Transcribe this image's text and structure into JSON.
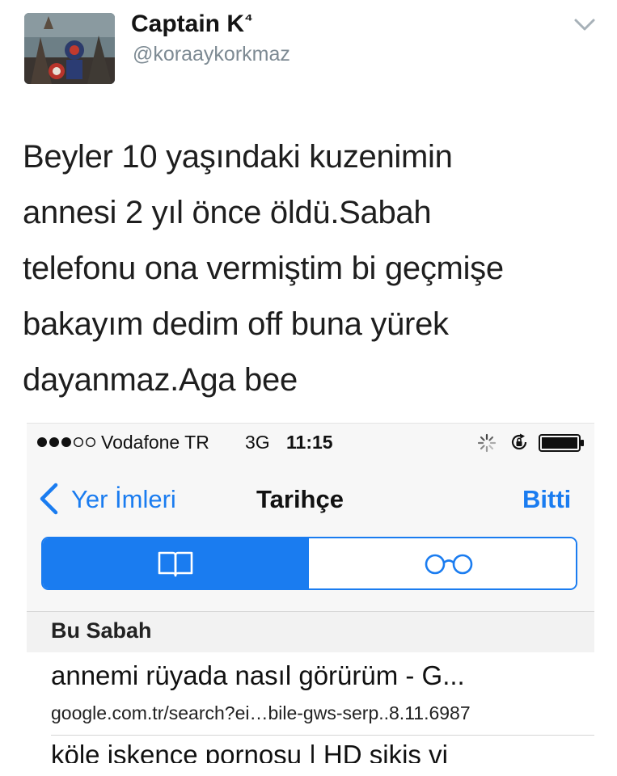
{
  "tweet": {
    "display_name": "Captain K",
    "name_badge": "⁴",
    "handle": "@koraaykorkmaz",
    "lines": [
      "Beyler 10 yaşındaki kuzenimin",
      "annesi 2 yıl önce öldü.Sabah",
      "telefonu ona vermiştim bi geçmişe",
      "bakayım dedim off buna yürek",
      "dayanmaz.Aga bee"
    ]
  },
  "phone": {
    "status_bar": {
      "carrier": "Vodafone TR",
      "network": "3G",
      "time": "11:15",
      "signal_bars_filled": 3,
      "signal_bars_total": 5
    },
    "nav": {
      "back_label": "Yer İmleri",
      "title": "Tarihçe",
      "done_label": "Bitti"
    },
    "segments": [
      {
        "icon": "book-icon",
        "selected": true
      },
      {
        "icon": "glasses-icon",
        "selected": false
      }
    ],
    "section_title": "Bu Sabah",
    "history": [
      {
        "title": "annemi rüyada nasıl görürüm - G...",
        "url": "google.com.tr/search?ei…bile-gws-serp..8.11.6987"
      },
      {
        "title": "köle işkence pornosu | HD sikiş vi"
      }
    ]
  },
  "colors": {
    "accent": "#1a7cf0",
    "handle": "#7d8a93",
    "text": "#1e1e1e"
  }
}
